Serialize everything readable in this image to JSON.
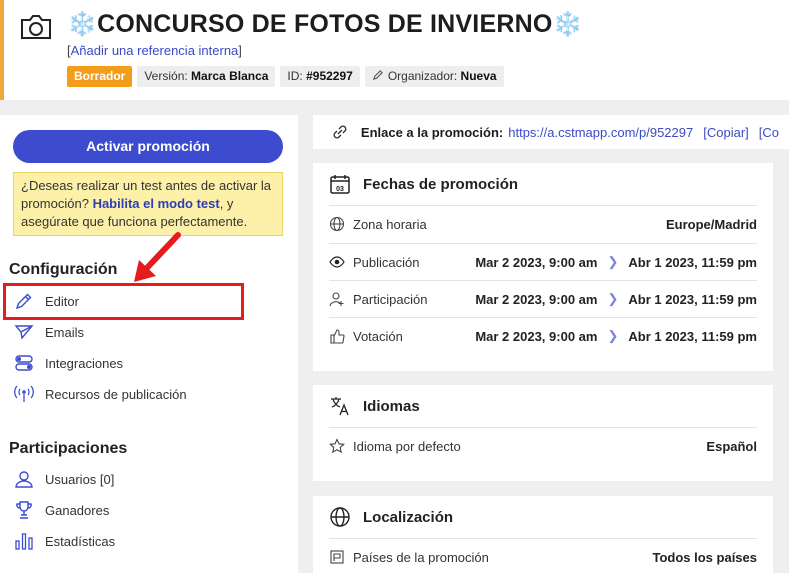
{
  "header": {
    "title": "CONCURSO DE FOTOS DE INVIERNO",
    "snowflake": "❄️",
    "ref_link": "Añadir una referencia interna",
    "badges": {
      "status": "Borrador",
      "version_label": "Versión:",
      "version_value": "Marca Blanca",
      "id_label": "ID:",
      "id_value": "#952297",
      "organizer_label": "Organizador:",
      "organizer_value": "Nueva"
    }
  },
  "sidebar": {
    "activate_label": "Activar promoción",
    "warning": {
      "text_before": "¿Deseas realizar un test antes de activar la promoción?",
      "link": "Habilita el modo test",
      "text_after": ", y asegúrate que funciona perfectamente."
    },
    "config_title": "Configuración",
    "config_items": [
      "Editor",
      "Emails",
      "Integraciones",
      "Recursos de publicación"
    ],
    "participations_title": "Participaciones",
    "participation_items": [
      "Usuarios [0]",
      "Ganadores",
      "Estadísticas"
    ]
  },
  "link_bar": {
    "label": "Enlace a la promoción:",
    "url": "https://a.cstmapp.com/p/952297",
    "copy": "[Copiar]",
    "more": "[Co"
  },
  "dates": {
    "title": "Fechas de promoción",
    "calendar_day": "03",
    "timezone_label": "Zona horaria",
    "timezone_value": "Europe/Madrid",
    "rows": [
      {
        "label": "Publicación",
        "start": "Mar 2 2023, 9:00 am",
        "end": "Abr 1 2023, 11:59 pm"
      },
      {
        "label": "Participación",
        "start": "Mar 2 2023, 9:00 am",
        "end": "Abr 1 2023, 11:59 pm"
      },
      {
        "label": "Votación",
        "start": "Mar 2 2023, 9:00 am",
        "end": "Abr 1 2023, 11:59 pm"
      }
    ]
  },
  "languages": {
    "title": "Idiomas",
    "default_label": "Idioma por defecto",
    "default_value": "Español"
  },
  "location": {
    "title": "Localización",
    "countries_label": "Países de la promoción",
    "countries_value": "Todos los países"
  },
  "colors": {
    "accent": "#3d4bcf",
    "status_orange": "#f39d1a",
    "warning_bg": "#fdf0a9",
    "highlight_red": "#e51c1c"
  }
}
